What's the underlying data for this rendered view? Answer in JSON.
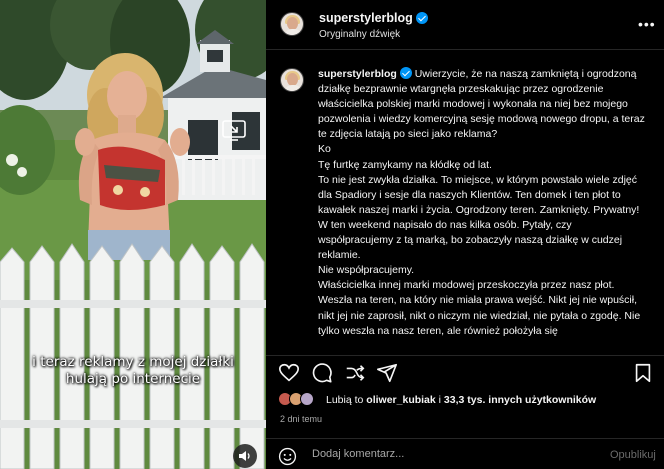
{
  "header": {
    "username": "superstylerblog",
    "audio": "Oryginalny dźwięk",
    "more": "•••"
  },
  "video": {
    "caption_line1": "i teraz reklamy z mojej działki",
    "caption_line2": "hulają po internecie"
  },
  "post": {
    "username": "superstylerblog",
    "paragraphs": [
      "Uwierzycie, że na naszą zamkniętą i ogrodzoną działkę bezprawnie wtargnęła przeskakując przez ogrodzenie właścicielka polskiej marki modowej i wykonała na niej bez mojego pozwolenia i wiedzy komercyjną sesję modową nowego dropu, a teraz te zdjęcia latają po sieci jako reklama?",
      "Ko",
      "Tę furtkę zamykamy na kłódkę od lat.",
      "To nie jest zwykła działka. To miejsce, w którym powstało wiele zdjęć dla Spadiory i sesje dla naszych Klientów. Ten domek i ten płot to kawałek naszej marki i życia. Ogrodzony teren. Zamknięty. Prywatny!",
      "W ten weekend napisało do nas kilka osób. Pytały, czy współpracujemy z tą marką, bo zobaczyły naszą działkę w cudzej reklamie.",
      "Nie współpracujemy.",
      "Właścicielka innej marki modowej przeskoczyła przez nasz płot. Weszła na teren, na który nie miała prawa wejść. Nikt jej nie wpuścił, nikt jej nie zaprosił, nikt o niczym nie wiedział, nie pytała o zgodę. Nie tylko weszła na nasz teren, ale również położyła się"
    ]
  },
  "likes": {
    "prefix": "Lubią to ",
    "user": "oliwer_kubiak",
    "middle": " i ",
    "count": "33,3 tys. innych użytkowników"
  },
  "time": "2 dni temu",
  "comment": {
    "placeholder": "Dodaj komentarz...",
    "publish": "Opublikuj"
  },
  "colors": {
    "verified": "#0095f6",
    "divider": "#262626",
    "muted": "#a8a8a8"
  },
  "icons": [
    "more-icon",
    "verified-icon",
    "heart-icon",
    "comment-icon",
    "share-icon",
    "send-icon",
    "bookmark-icon",
    "emoji-icon",
    "volume-icon",
    "view-icon"
  ]
}
